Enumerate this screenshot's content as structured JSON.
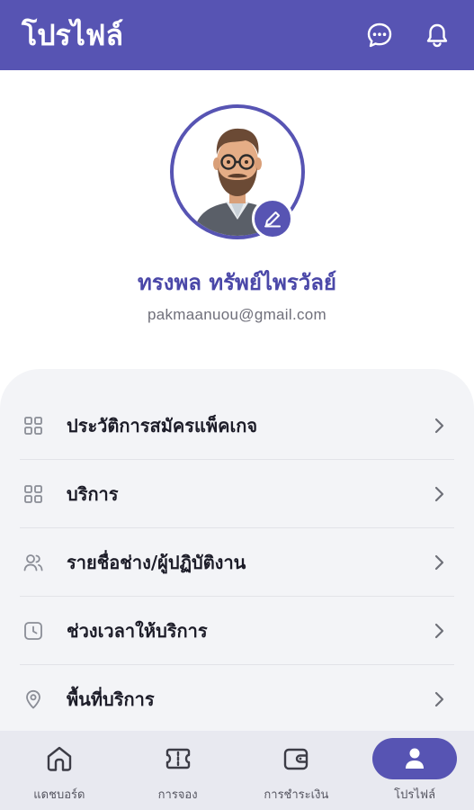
{
  "header": {
    "title": "โปรไฟล์",
    "icons": [
      "chat-icon",
      "bell-icon"
    ]
  },
  "profile": {
    "name": "ทรงพล ทรัพย์ไพรวัลย์",
    "email": "pakmaanuou@gmail.com"
  },
  "menu": {
    "items": [
      {
        "label": "ประวัติการสมัครแพ็คเกจ",
        "icon": "grid-icon"
      },
      {
        "label": "บริการ",
        "icon": "grid-icon"
      },
      {
        "label": "รายชื่อช่าง/ผู้ปฏิบัติงาน",
        "icon": "users-icon"
      },
      {
        "label": "ช่วงเวลาให้บริการ",
        "icon": "clock-icon"
      },
      {
        "label": "พื้นที่บริการ",
        "icon": "location-pin-icon"
      }
    ]
  },
  "nav": {
    "items": [
      {
        "label": "แดชบอร์ด",
        "icon": "home-icon"
      },
      {
        "label": "การจอง",
        "icon": "ticket-icon"
      },
      {
        "label": "การชำระเงิน",
        "icon": "wallet-icon"
      },
      {
        "label": "โปรไฟล์",
        "icon": "user-icon"
      }
    ],
    "active": "โปรไฟล์"
  },
  "colors": {
    "primary": "#5754b3",
    "name_text": "#4a47a8",
    "menu_bg": "#f3f4f7",
    "nav_bg": "#e8e9f0"
  }
}
